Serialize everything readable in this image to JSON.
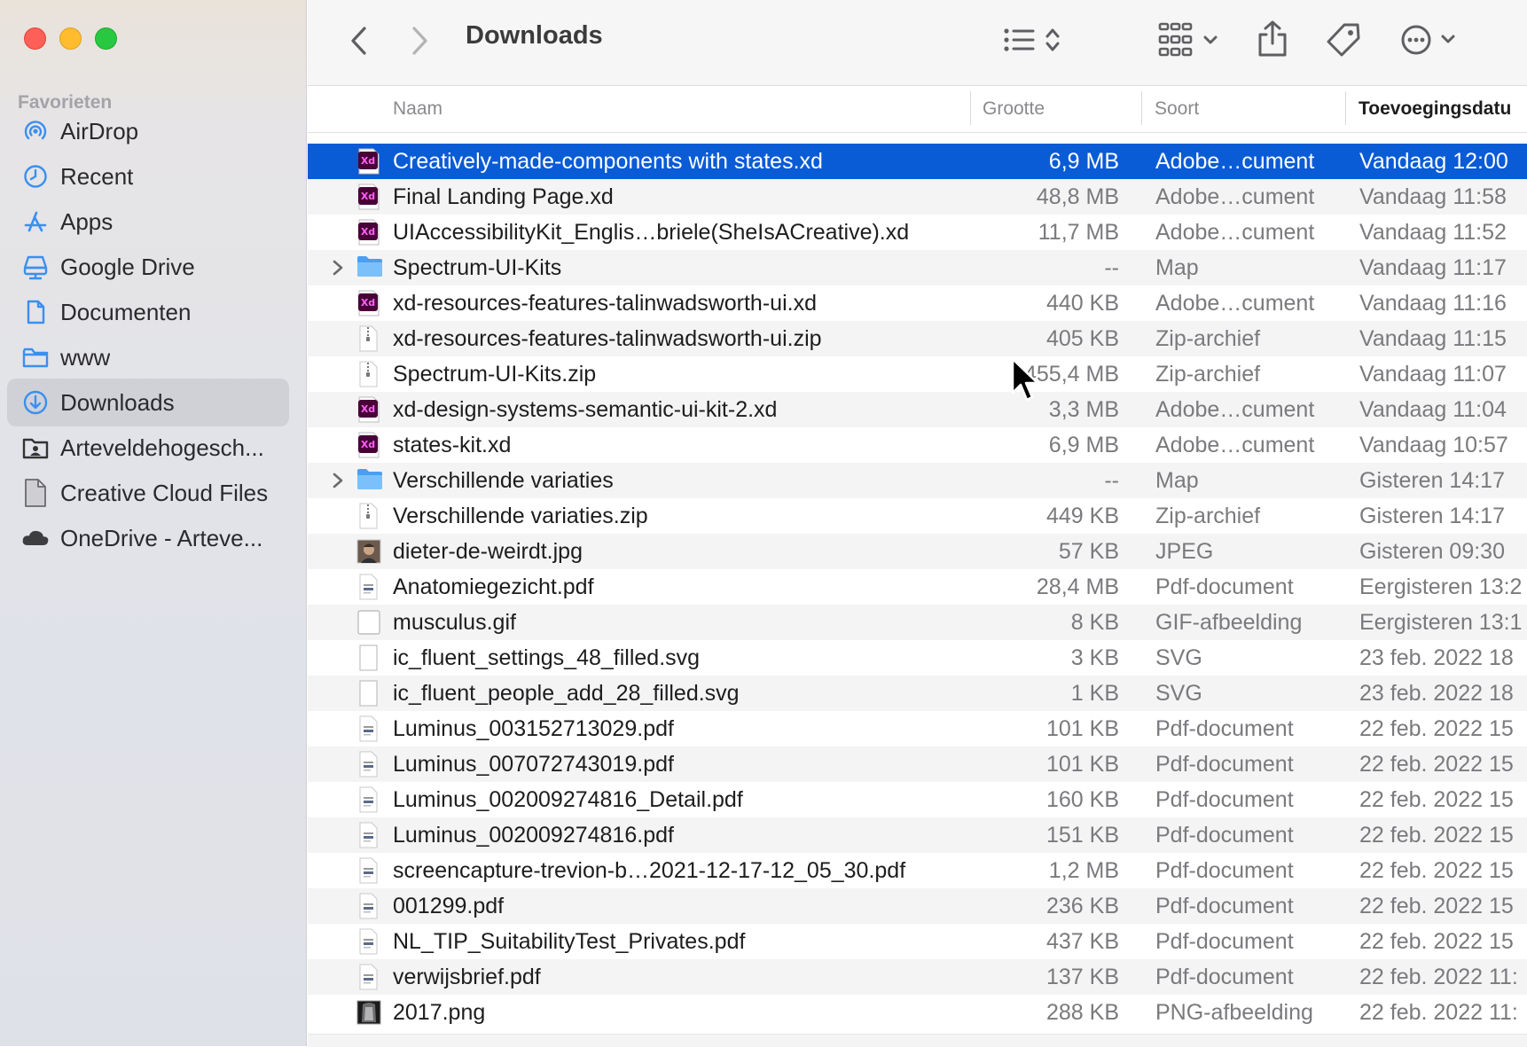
{
  "window": {
    "title": "Downloads",
    "traffic_lights": [
      "close",
      "minimize",
      "maximize"
    ]
  },
  "toolbar": {
    "back_icon": "chevron-left-icon",
    "forward_icon": "chevron-right-icon",
    "view_icon": "list-view-icon",
    "group_icon": "grid-group-icon",
    "share_icon": "share-icon",
    "tag_icon": "tag-icon",
    "more_icon": "ellipsis-circle-icon"
  },
  "sidebar": {
    "section_title": "Favorieten",
    "items": [
      {
        "label": "AirDrop",
        "icon": "airdrop-icon"
      },
      {
        "label": "Recent",
        "icon": "clock-icon"
      },
      {
        "label": "Apps",
        "icon": "apps-icon"
      },
      {
        "label": "Google Drive",
        "icon": "drive-icon"
      },
      {
        "label": "Documenten",
        "icon": "document-icon"
      },
      {
        "label": "www",
        "icon": "folder-icon"
      },
      {
        "label": "Downloads",
        "icon": "download-icon",
        "active": true
      },
      {
        "label": "Arteveldehogesch...",
        "icon": "folder-person-icon"
      },
      {
        "label": "Creative Cloud Files",
        "icon": "file-icon"
      },
      {
        "label": "OneDrive - Arteve...",
        "icon": "cloud-icon"
      }
    ]
  },
  "columns": {
    "name": "Naam",
    "size": "Grootte",
    "kind": "Soort",
    "date": "Toevoegingsdatu"
  },
  "files": [
    {
      "name": "Creatively-made-components with states.xd",
      "size": "6,9 MB",
      "kind": "Adobe…cument",
      "date": "Vandaag 12:00",
      "type": "xd",
      "selected": true
    },
    {
      "name": "Final Landing Page.xd",
      "size": "48,8 MB",
      "kind": "Adobe…cument",
      "date": "Vandaag 11:58",
      "type": "xd"
    },
    {
      "name": "UIAccessibilityKit_Englis…briele(SheIsACreative).xd",
      "size": "11,7 MB",
      "kind": "Adobe…cument",
      "date": "Vandaag 11:52",
      "type": "xd"
    },
    {
      "name": "Spectrum-UI-Kits",
      "size": "--",
      "kind": "Map",
      "date": "Vandaag 11:17",
      "type": "folder"
    },
    {
      "name": "xd-resources-features-talinwadsworth-ui.xd",
      "size": "440 KB",
      "kind": "Adobe…cument",
      "date": "Vandaag 11:16",
      "type": "xd"
    },
    {
      "name": "xd-resources-features-talinwadsworth-ui.zip",
      "size": "405 KB",
      "kind": "Zip-archief",
      "date": "Vandaag 11:15",
      "type": "zip"
    },
    {
      "name": "Spectrum-UI-Kits.zip",
      "size": "455,4 MB",
      "kind": "Zip-archief",
      "date": "Vandaag 11:07",
      "type": "zip"
    },
    {
      "name": "xd-design-systems-semantic-ui-kit-2.xd",
      "size": "3,3 MB",
      "kind": "Adobe…cument",
      "date": "Vandaag 11:04",
      "type": "xd"
    },
    {
      "name": "states-kit.xd",
      "size": "6,9 MB",
      "kind": "Adobe…cument",
      "date": "Vandaag 10:57",
      "type": "xd"
    },
    {
      "name": "Verschillende variaties",
      "size": "--",
      "kind": "Map",
      "date": "Gisteren 14:17",
      "type": "folder"
    },
    {
      "name": "Verschillende variaties.zip",
      "size": "449 KB",
      "kind": "Zip-archief",
      "date": "Gisteren 14:17",
      "type": "zip"
    },
    {
      "name": "dieter-de-weirdt.jpg",
      "size": "57 KB",
      "kind": "JPEG",
      "date": "Gisteren 09:30",
      "type": "photo"
    },
    {
      "name": "Anatomiegezicht.pdf",
      "size": "28,4 MB",
      "kind": "Pdf-document",
      "date": "Eergisteren 13:2",
      "type": "pdf"
    },
    {
      "name": "musculus.gif",
      "size": "8 KB",
      "kind": "GIF-afbeelding",
      "date": "Eergisteren 13:1",
      "type": "blank"
    },
    {
      "name": "ic_fluent_settings_48_filled.svg",
      "size": "3 KB",
      "kind": "SVG",
      "date": "23 feb. 2022 18",
      "type": "page"
    },
    {
      "name": "ic_fluent_people_add_28_filled.svg",
      "size": "1 KB",
      "kind": "SVG",
      "date": "23 feb. 2022 18",
      "type": "page"
    },
    {
      "name": "Luminus_003152713029.pdf",
      "size": "101 KB",
      "kind": "Pdf-document",
      "date": "22 feb. 2022 15",
      "type": "pdf"
    },
    {
      "name": "Luminus_007072743019.pdf",
      "size": "101 KB",
      "kind": "Pdf-document",
      "date": "22 feb. 2022 15",
      "type": "pdf"
    },
    {
      "name": "Luminus_002009274816_Detail.pdf",
      "size": "160 KB",
      "kind": "Pdf-document",
      "date": "22 feb. 2022 15",
      "type": "pdf"
    },
    {
      "name": "Luminus_002009274816.pdf",
      "size": "151 KB",
      "kind": "Pdf-document",
      "date": "22 feb. 2022 15",
      "type": "pdf"
    },
    {
      "name": "screencapture-trevion-b…2021-12-17-12_05_30.pdf",
      "size": "1,2 MB",
      "kind": "Pdf-document",
      "date": "22 feb. 2022 15",
      "type": "pdf"
    },
    {
      "name": "001299.pdf",
      "size": "236 KB",
      "kind": "Pdf-document",
      "date": "22 feb. 2022 15",
      "type": "pdf"
    },
    {
      "name": "NL_TIP_SuitabilityTest_Privates.pdf",
      "size": "437 KB",
      "kind": "Pdf-document",
      "date": "22 feb. 2022 15",
      "type": "pdf"
    },
    {
      "name": "verwijsbrief.pdf",
      "size": "137 KB",
      "kind": "Pdf-document",
      "date": "22 feb. 2022 11:",
      "type": "pdf"
    },
    {
      "name": "2017.png",
      "size": "288 KB",
      "kind": "PNG-afbeelding",
      "date": "22 feb. 2022 11:",
      "type": "xray"
    }
  ],
  "colors": {
    "selection": "#0a5bd6",
    "xd_icon": "#470137",
    "xd_accent": "#ff61f6",
    "folder": "#5aaef5",
    "sidebar_accent": "#3a8ff0"
  }
}
